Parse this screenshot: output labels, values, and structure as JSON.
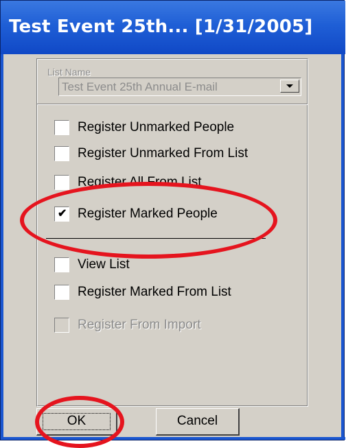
{
  "window": {
    "title": "Test Event 25th... [1/31/2005]"
  },
  "list_name": {
    "label": "List Name",
    "value": "Test Event 25th Annual E-mail"
  },
  "options": {
    "register_unmarked_people": {
      "label": "Register Unmarked People",
      "checked": false,
      "enabled": true
    },
    "register_unmarked_from_list": {
      "label": "Register Unmarked From List",
      "checked": false,
      "enabled": true
    },
    "register_all_from_list": {
      "label": "Register All From List",
      "checked": false,
      "enabled": true
    },
    "register_marked_people": {
      "label": "Register Marked People",
      "checked": true,
      "enabled": true
    },
    "view_list": {
      "label": "View List",
      "checked": false,
      "enabled": true
    },
    "register_marked_from_list": {
      "label": "Register Marked From List",
      "checked": false,
      "enabled": true
    },
    "register_from_import": {
      "label": "Register From Import",
      "checked": false,
      "enabled": false
    }
  },
  "buttons": {
    "ok_label": "OK",
    "cancel_label": "Cancel"
  },
  "icons": {
    "checkmark": "check-icon",
    "dropdown": "dropdown-arrow-icon"
  },
  "colors": {
    "title_bar": "#1f5fd6",
    "dialog_face": "#d4d0c8",
    "annotation": "#e5141e",
    "disabled_text": "#8c8c8c"
  }
}
